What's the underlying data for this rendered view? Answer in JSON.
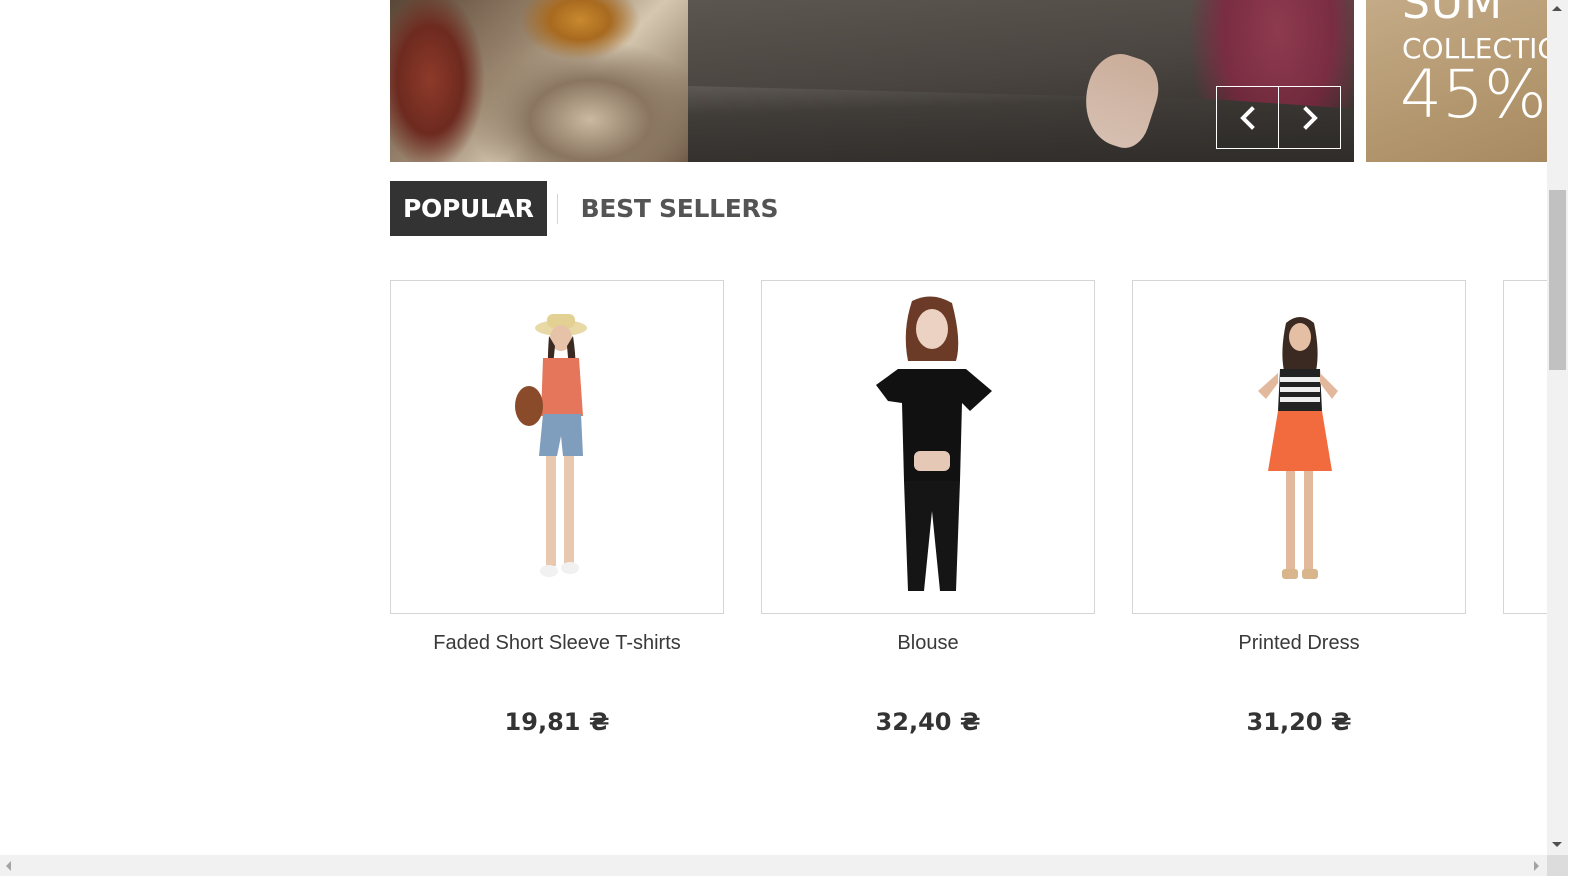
{
  "banner": {
    "promo": {
      "line1": "SUM",
      "line2": "COLLECTIO",
      "line3": "45%"
    },
    "nav": {
      "prev_icon": "chevron-left-icon",
      "next_icon": "chevron-right-icon"
    }
  },
  "tabs": [
    {
      "label": "POPULAR",
      "active": true
    },
    {
      "label": "BEST SELLERS",
      "active": false
    }
  ],
  "products": [
    {
      "name": "Faded Short Sleeve T-shirts",
      "price": "19,81 ₴"
    },
    {
      "name": "Blouse",
      "price": "32,40 ₴"
    },
    {
      "name": "Printed Dress",
      "price": "31,20 ₴"
    }
  ],
  "colors": {
    "tab_active_bg": "#333333",
    "text": "#333333",
    "border": "#d6d4d4"
  }
}
